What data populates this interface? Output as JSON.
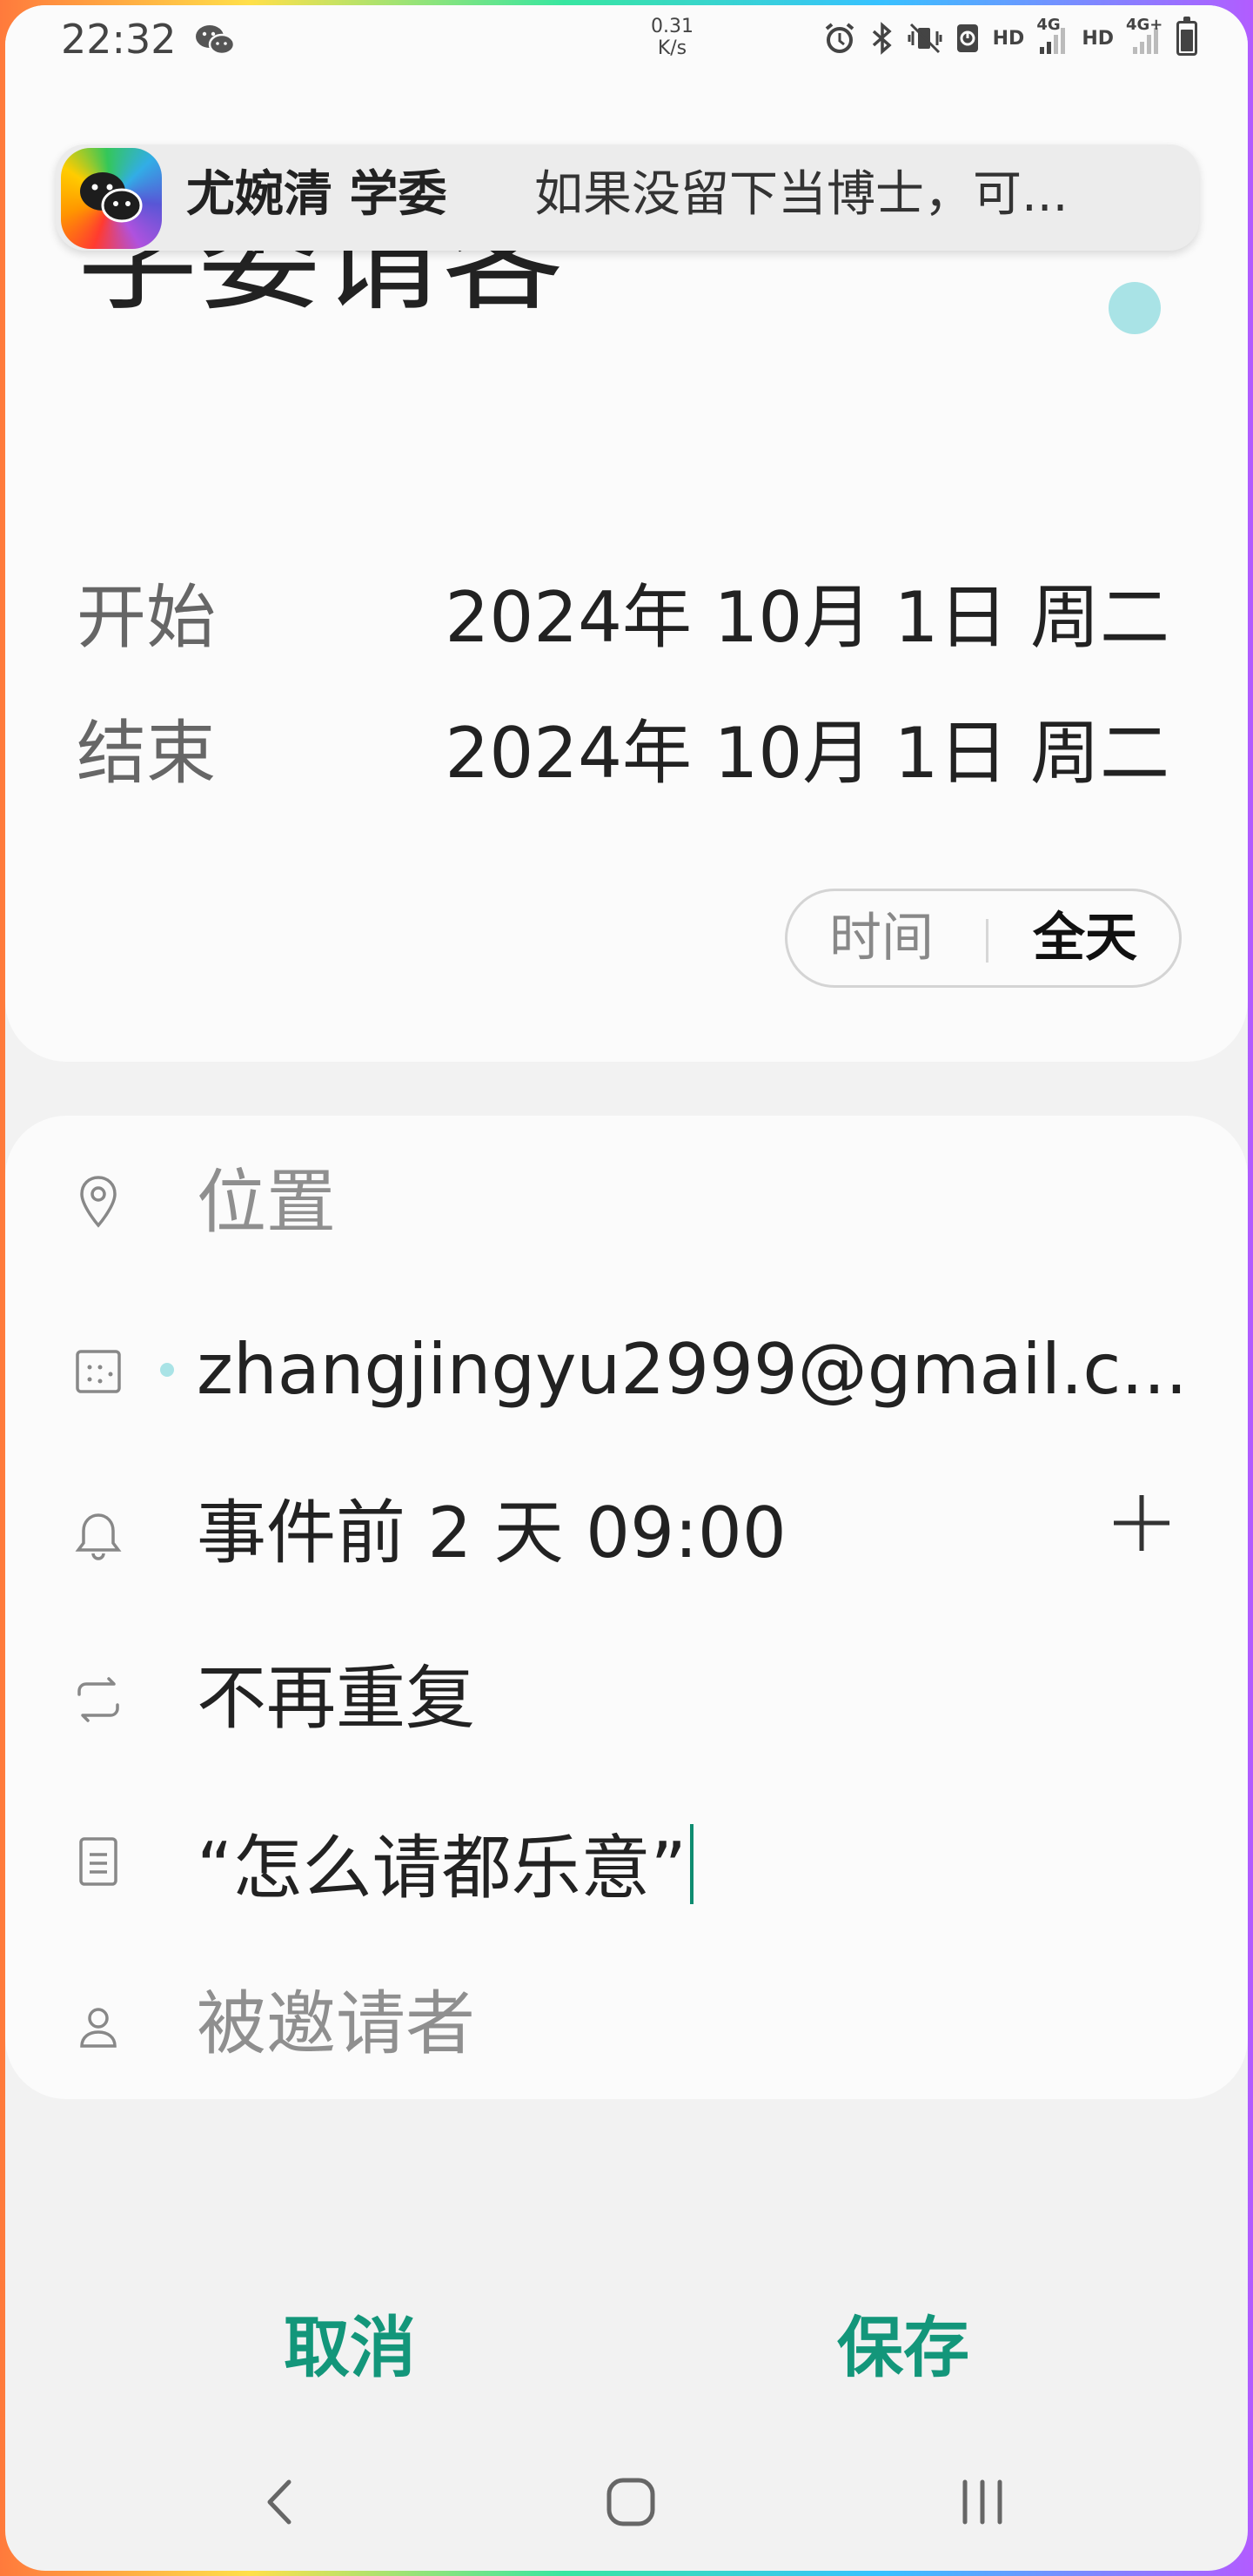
{
  "status_bar": {
    "time": "22:32",
    "net_speed_value": "0.31",
    "net_speed_unit": "K/s",
    "hd1": "HD",
    "net1": "4G",
    "hd2": "HD",
    "net2": "4G+",
    "battery_level": 0.85,
    "icons": [
      "wechat-icon",
      "alarm-icon",
      "bluetooth-icon",
      "mute-vibrate-icon",
      "battery-saver-icon",
      "signal-icon",
      "battery-icon"
    ]
  },
  "notification": {
    "sender": "尤婉清  学委",
    "message": "如果没留下当博士，可..."
  },
  "event": {
    "title": "学委请客",
    "color": "#a9e3e6",
    "start_label": "开始",
    "start_value": "2024年 10月 1日 周二",
    "end_label": "结束",
    "end_value": "2024年 10月 1日 周二",
    "toggle_time": "时间",
    "toggle_all_day": "全天"
  },
  "fields": {
    "location_placeholder": "位置",
    "calendar_account": "zhangjingyu2999@gmail.c...",
    "reminder": "事件前 2 天 09:00",
    "repeat": "不再重复",
    "note": "“怎么请都乐意”",
    "invitees_placeholder": "被邀请者"
  },
  "actions": {
    "cancel": "取消",
    "save": "保存"
  },
  "accent_color": "#13967a"
}
